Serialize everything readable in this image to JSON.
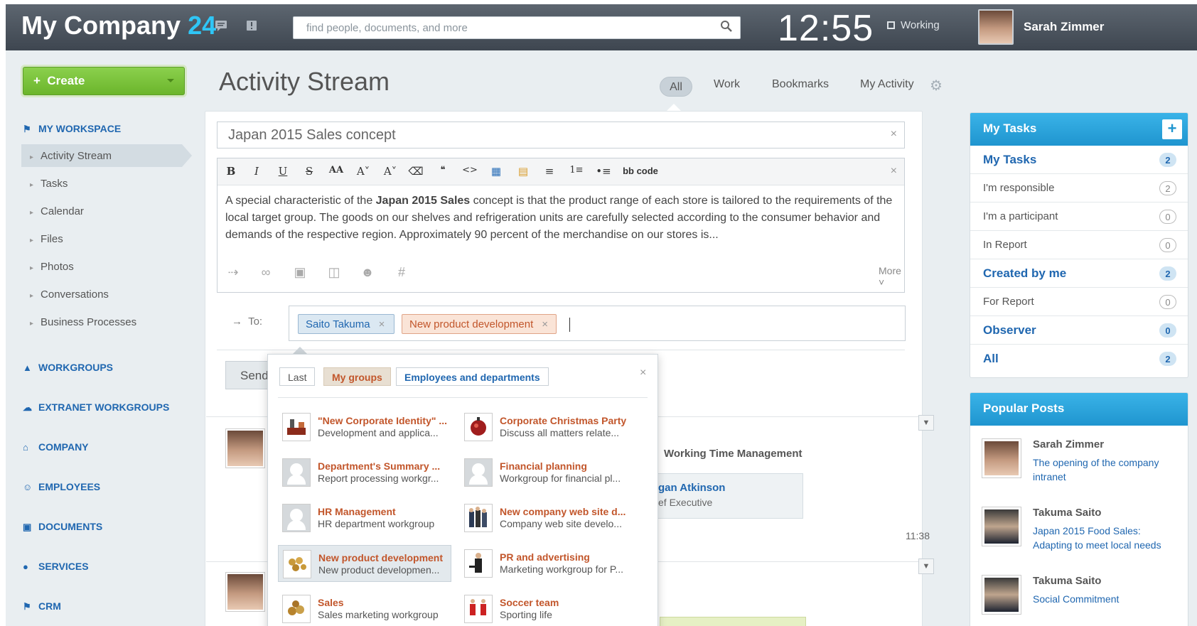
{
  "header": {
    "logo_text": "My Company",
    "logo_number": "24",
    "search_placeholder": "find people, documents, and more",
    "clock": "12:55",
    "status": "Working",
    "user_name": "Sarah Zimmer"
  },
  "sidebar": {
    "create_label": "Create",
    "workspace_label": "MY WORKSPACE",
    "workspace_items": [
      "Activity Stream",
      "Tasks",
      "Calendar",
      "Files",
      "Photos",
      "Conversations",
      "Business Processes"
    ],
    "sections": [
      "WORKGROUPS",
      "EXTRANET WORKGROUPS",
      "COMPANY",
      "EMPLOYEES",
      "DOCUMENTS",
      "SERVICES",
      "CRM"
    ]
  },
  "page": {
    "title": "Activity Stream",
    "tabs": [
      "All",
      "Work",
      "Bookmarks",
      "My Activity"
    ]
  },
  "composer": {
    "post_title": "Japan 2015 Sales concept",
    "bbcode_label": "bb code",
    "body_before": "A special characteristic of the ",
    "body_bold": "Japan 2015 Sales",
    "body_after": " concept is that the product range of each store is tailored to the requirements of the local target group. The goods on our shelves and refrigeration units are carefully selected according to the consumer behavior and demands of the respective region. Approximately 90 percent of the merchandise on our stores is...",
    "more_label": "More",
    "to_label": "To:",
    "recipients": [
      "Saito Takuma",
      "New product development"
    ],
    "send_label": "Send"
  },
  "feed": {
    "item_title_fragment": "Working Time Management",
    "card_name_fragment": "gan Atkinson",
    "card_role_fragment": "ef Executive",
    "time": "11:38"
  },
  "group_picker": {
    "tabs": [
      "Last",
      "My groups",
      "Employees and departments"
    ],
    "groups": [
      {
        "name": "\"New Corporate Identity\" ...",
        "desc": "Development and applica...",
        "icon": "corporate-identity-icon"
      },
      {
        "name": "Corporate Christmas Party",
        "desc": "Discuss all matters relate...",
        "icon": "christmas-party-icon"
      },
      {
        "name": "Department's Summary ...",
        "desc": "Report processing workgr...",
        "icon": "default-group-icon"
      },
      {
        "name": "Financial planning",
        "desc": "Workgroup for financial pl...",
        "icon": "default-group-icon"
      },
      {
        "name": "HR Management",
        "desc": "HR department workgroup",
        "icon": "default-group-icon"
      },
      {
        "name": "New company web site d...",
        "desc": "Company web site develo...",
        "icon": "web-site-team-icon"
      },
      {
        "name": "New product development",
        "desc": "New product developmen...",
        "icon": "product-development-icon"
      },
      {
        "name": "PR and advertising",
        "desc": "Marketing workgroup for P...",
        "icon": "pr-advertising-icon"
      },
      {
        "name": "Sales",
        "desc": "Sales marketing workgroup",
        "icon": "sales-icon"
      },
      {
        "name": "Soccer team",
        "desc": "Sporting life",
        "icon": "soccer-team-icon"
      }
    ],
    "selected": "New product development"
  },
  "tasks_widget": {
    "title": "My Tasks",
    "rows": [
      {
        "label": "My Tasks",
        "count": "2",
        "bold": true
      },
      {
        "label": "I'm responsible",
        "count": "2",
        "bold": false
      },
      {
        "label": "I'm a participant",
        "count": "0",
        "bold": false
      },
      {
        "label": "In Report",
        "count": "0",
        "bold": false
      },
      {
        "label": "Created by me",
        "count": "2",
        "bold": true
      },
      {
        "label": "For Report",
        "count": "0",
        "bold": false
      },
      {
        "label": "Observer",
        "count": "0",
        "bold": true
      },
      {
        "label": "All",
        "count": "2",
        "bold": true
      }
    ]
  },
  "popular_widget": {
    "title": "Popular Posts",
    "posts": [
      {
        "author": "Sarah Zimmer",
        "title": "The opening of the company intranet"
      },
      {
        "author": "Takuma Saito",
        "title": "Japan 2015 Food Sales: Adapting to meet local needs"
      },
      {
        "author": "Takuma Saito",
        "title": "Social Commitment"
      }
    ]
  },
  "colors": {
    "accent_blue": "#2067b0",
    "create_green": "#7cc13a",
    "group_orange": "#c2562b",
    "widget_header": "#2aa4dc"
  }
}
